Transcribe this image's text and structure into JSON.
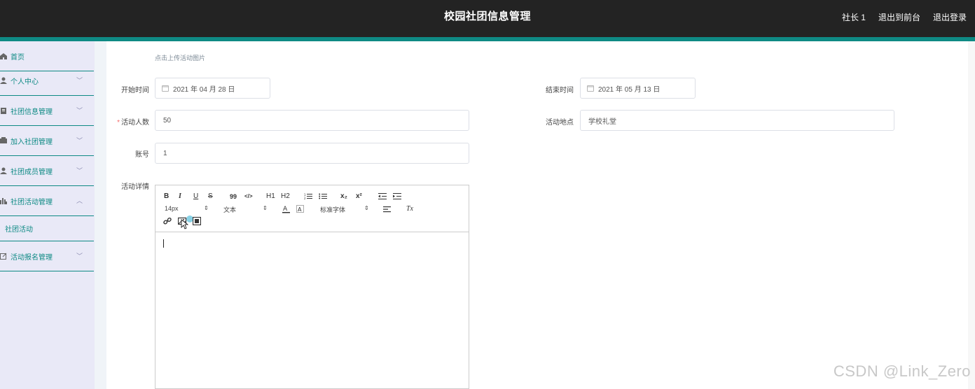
{
  "header": {
    "title": "校园社团信息管理",
    "user": "社长 1",
    "front_link": "退出到前台",
    "logout_link": "退出登录"
  },
  "sidebar": {
    "items": [
      {
        "label": "首页"
      },
      {
        "label": "个人中心"
      },
      {
        "label": "社团信息管理"
      },
      {
        "label": "加入社团管理"
      },
      {
        "label": "社团成员管理"
      },
      {
        "label": "社团活动管理"
      },
      {
        "label": "活动报名管理"
      }
    ],
    "sub_item": "社团活动"
  },
  "form": {
    "upload_hint": "点击上传活动图片",
    "start_label": "开始时间",
    "start_value": "2021 年 04 月 28 日",
    "end_label": "结束时间",
    "end_value": "2021 年 05 月 13 日",
    "count_label": "活动人数",
    "count_value": "50",
    "place_label": "活动地点",
    "place_value": "学校礼堂",
    "account_label": "账号",
    "account_value": "1",
    "detail_label": "活动详情"
  },
  "editor": {
    "toolbar": {
      "bold": "B",
      "italic": "I",
      "underline": "U",
      "strike": "S",
      "quote": "99",
      "code": "</>",
      "h1": "H1",
      "h2": "H2",
      "sub": "x₂",
      "sup": "x²",
      "size": "14px",
      "format": "文本",
      "font": "标准字体",
      "clean": "Tx"
    }
  },
  "watermark": "CSDN @Link_Zero",
  "colors": {
    "accent": "#0e8a84",
    "header_bg": "#232323",
    "sidebar_bg": "#e9e9f7"
  }
}
